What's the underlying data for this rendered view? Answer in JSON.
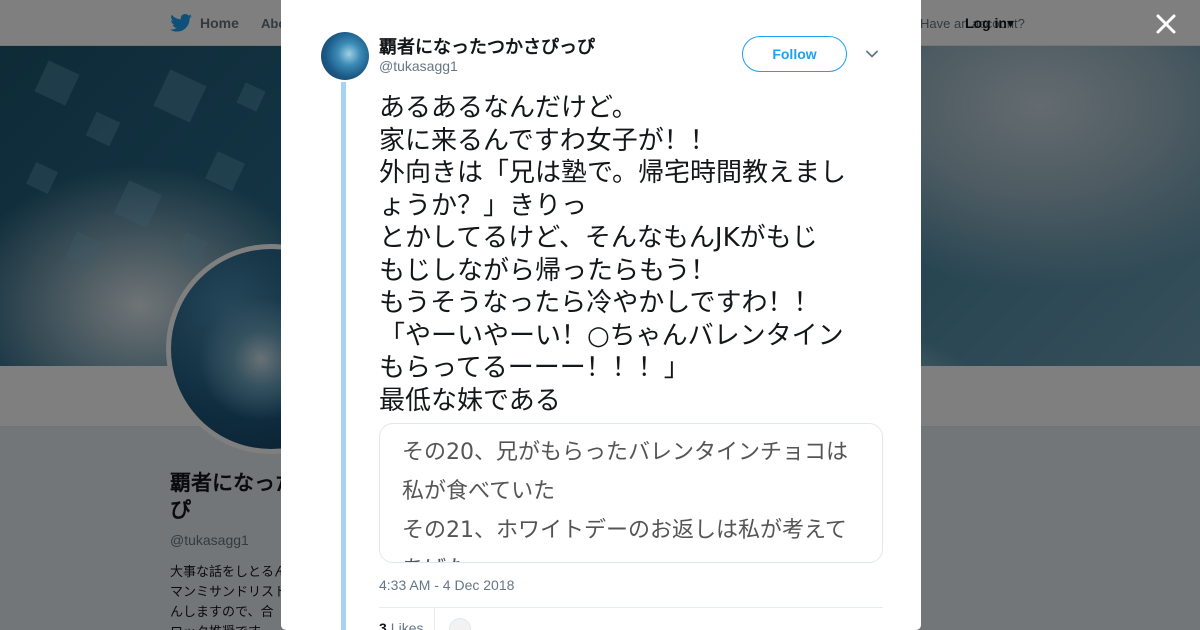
{
  "topbar": {
    "home_label": "Home",
    "about_label": "About",
    "account_label": "Have an account?",
    "login_label": "Log in"
  },
  "profile": {
    "name_line1": "覇者になったつかさぴっぴ",
    "name_line2": "ぴ",
    "handle": "@tukasagg1",
    "bio_lines": [
      "大事な話をしとるんよ",
      "マンミサンドリスト",
      "んしますので、合",
      "ロック推奨です"
    ]
  },
  "tweet": {
    "author_name": "覇者になったつかさぴっぴ",
    "author_handle": "@tukasagg1",
    "follow_label": "Follow",
    "text_lines": [
      "あるあるなんだけど。",
      "家に来るんですわ女子が！！",
      "外向きは「兄は塾で。帰宅時間教えまし",
      "ょうか？」きりっ",
      "とかしてるけど、そんなもんJKがもじ",
      "もじしながら帰ったらもう！",
      "もうそうなったら冷やかしですわ！！",
      "「やーいやーい！○ちゃんバレンタイン",
      "もらってるーーー！！！」",
      "最低な妹である"
    ],
    "media_lines": [
      "その20、兄がもらったバレンタインチョコは",
      "私が食べていた",
      "その21、ホワイトデーのお返しは私が考えて",
      "あげた"
    ],
    "timestamp": "4:33 AM - 4 Dec 2018",
    "likes_count": "3",
    "likes_label": "Likes"
  },
  "colors": {
    "brand_blue": "#1da1f2",
    "thread_line": "#a5d3f6",
    "text_primary": "#14171a",
    "text_secondary": "#657786"
  },
  "icons": [
    "twitter-bird-icon",
    "close-icon",
    "chevron-down-icon",
    "caret-down-icon"
  ]
}
